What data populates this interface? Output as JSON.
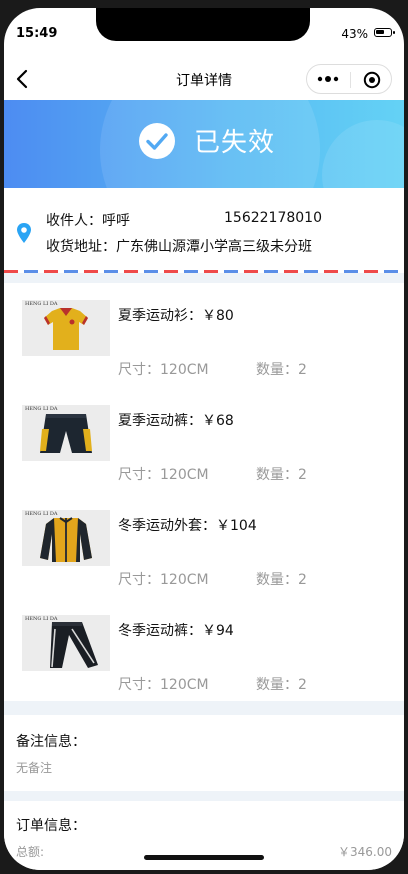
{
  "status_bar": {
    "time": "15:49",
    "battery": "43%"
  },
  "navbar": {
    "title": "订单详情"
  },
  "banner": {
    "status": "已失效"
  },
  "address": {
    "recipient_label": "收件人：",
    "recipient": "呼呼",
    "phone": "15622178010",
    "address_label": "收货地址：",
    "address": "广东佛山源潭小学高三级未分班"
  },
  "goods": [
    {
      "name": "夏季运动衫：￥80",
      "size": "尺寸：120CM",
      "qty": "数量：2",
      "brand": "HENG LI DA"
    },
    {
      "name": "夏季运动裤：￥68",
      "size": "尺寸：120CM",
      "qty": "数量：2",
      "brand": "HENG LI DA"
    },
    {
      "name": "冬季运动外套：￥104",
      "size": "尺寸：120CM",
      "qty": "数量：2",
      "brand": "HENG LI DA"
    },
    {
      "name": "冬季运动裤：￥94",
      "size": "尺寸：120CM",
      "qty": "数量：2",
      "brand": "HENG LI DA"
    }
  ],
  "remark": {
    "title": "备注信息：",
    "value": "无备注"
  },
  "order": {
    "title": "订单信息：",
    "total_label": "总额:",
    "total_value": "￥346.00"
  },
  "colors": {
    "banner_start": "#4d8cf2",
    "banner_end": "#64d2f5",
    "pin": "#2aa4f4",
    "stripe_red": "#ef4a4a",
    "stripe_blue": "#5a8ee8"
  }
}
